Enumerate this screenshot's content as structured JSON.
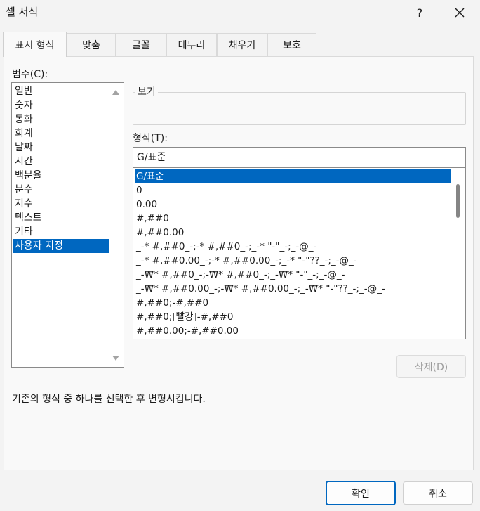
{
  "window": {
    "title": "셀 서식",
    "help_label": "?",
    "close_icon": "close-icon"
  },
  "tabs": [
    {
      "label": "표시 형식",
      "active": true
    },
    {
      "label": "맞춤"
    },
    {
      "label": "글꼴"
    },
    {
      "label": "테두리"
    },
    {
      "label": "채우기"
    },
    {
      "label": "보호"
    }
  ],
  "category": {
    "label": "범주(C):",
    "items": [
      "일반",
      "숫자",
      "통화",
      "회계",
      "날짜",
      "시간",
      "백분율",
      "분수",
      "지수",
      "텍스트",
      "기타",
      "사용자 지정"
    ],
    "selected": "사용자 지정"
  },
  "preview": {
    "label": "보기",
    "value": ""
  },
  "format": {
    "label": "형식(T):",
    "input_value": "G/표준",
    "items": [
      "G/표준",
      "0",
      "0.00",
      "#,##0",
      "#,##0.00",
      "_-* #,##0_-;-* #,##0_-;_-* \"-\"_-;_-@_-",
      "_-* #,##0.00_-;-* #,##0.00_-;_-* \"-\"??_-;_-@_-",
      "_-₩* #,##0_-;-₩* #,##0_-;_-₩* \"-\"_-;_-@_-",
      "_-₩* #,##0.00_-;-₩* #,##0.00_-;_-₩* \"-\"??_-;_-@_-",
      "#,##0;-#,##0",
      "#,##0;[빨강]-#,##0",
      "#,##0.00;-#,##0.00"
    ],
    "selected": "G/표준"
  },
  "delete_label": "삭제(D)",
  "description": "기존의 형식 중 하나를 선택한 후 변형시킵니다.",
  "footer": {
    "ok_label": "확인",
    "cancel_label": "취소"
  },
  "colors": {
    "accent": "#0067c0",
    "selection_text": "#ffffff",
    "disabled_text": "#9d9d9d"
  }
}
